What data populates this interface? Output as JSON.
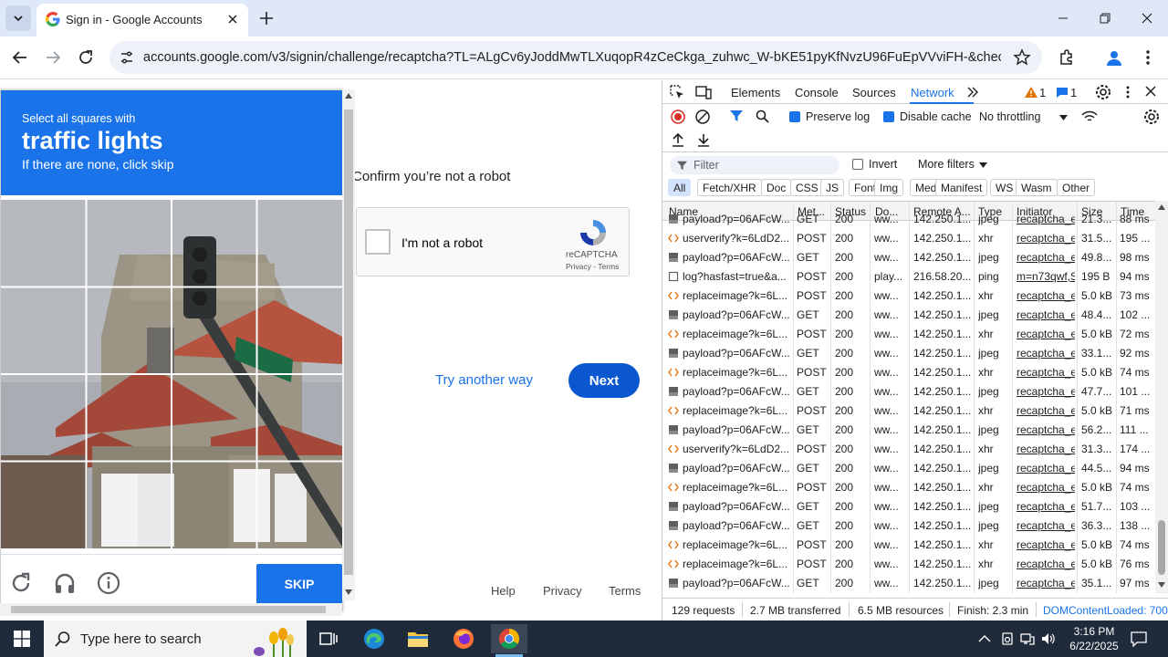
{
  "browser": {
    "tab_title": "Sign in - Google Accounts",
    "url": "accounts.google.com/v3/signin/challenge/recaptcha?TL=ALgCv6yJoddMwTLXuqopR4zCeCkga_zuhwc_W-bKE51pyKfNvzU96FuEpVVviFH-&checkConn..."
  },
  "captcha": {
    "instruction_line1": "Select all squares with",
    "instruction_target": "traffic lights",
    "instruction_line3": "If there are none, click skip",
    "skip_label": "SKIP",
    "icons": [
      "reload-icon",
      "headphones-icon",
      "info-icon"
    ]
  },
  "signin": {
    "confirm_text": "Confirm you’re not a robot",
    "checkbox_label": "I'm not a robot",
    "recaptcha_brand": "reCAPTCHA",
    "privacy_terms": "Privacy - Terms",
    "try_another": "Try another way",
    "next": "Next",
    "footer": {
      "help": "Help",
      "privacy": "Privacy",
      "terms": "Terms"
    }
  },
  "devtools": {
    "tabs": [
      "Elements",
      "Console",
      "Sources",
      "Network"
    ],
    "active_tab": "Network",
    "warnings": "1",
    "messages": "1",
    "preserve_log": "Preserve log",
    "disable_cache": "Disable cache",
    "throttling": "No throttling",
    "filter_placeholder": "Filter",
    "invert": "Invert",
    "more_filters": "More filters",
    "type_filters": [
      "All",
      "Fetch/XHR",
      "Doc",
      "CSS",
      "JS",
      "Font",
      "Img",
      "Media",
      "Manifest",
      "WS",
      "Wasm",
      "Other"
    ],
    "columns": [
      "Name",
      "Met...",
      "Status",
      "Do...",
      "Remote A...",
      "Type",
      "Initiator",
      "Size",
      "Time"
    ],
    "rows": [
      {
        "name": "payload?p=06AFcW...",
        "method": "GET",
        "status": "200",
        "domain": "ww...",
        "remote": "142.250.1...",
        "type": "jpeg",
        "initiator": "recaptcha_e",
        "size": "21.3...",
        "time": "88 ms",
        "icon": "img"
      },
      {
        "name": "userverify?k=6LdD2...",
        "method": "POST",
        "status": "200",
        "domain": "ww...",
        "remote": "142.250.1...",
        "type": "xhr",
        "initiator": "recaptcha_e",
        "size": "31.5...",
        "time": "195 ...",
        "icon": "xhr"
      },
      {
        "name": "payload?p=06AFcW...",
        "method": "GET",
        "status": "200",
        "domain": "ww...",
        "remote": "142.250.1...",
        "type": "jpeg",
        "initiator": "recaptcha_e",
        "size": "49.8...",
        "time": "98 ms",
        "icon": "img"
      },
      {
        "name": "log?hasfast=true&a...",
        "method": "POST",
        "status": "200",
        "domain": "play...",
        "remote": "216.58.20...",
        "type": "ping",
        "initiator": "m=n73qwf,S",
        "size": "195 B",
        "time": "94 ms",
        "icon": "doc"
      },
      {
        "name": "replaceimage?k=6L...",
        "method": "POST",
        "status": "200",
        "domain": "ww...",
        "remote": "142.250.1...",
        "type": "xhr",
        "initiator": "recaptcha_e",
        "size": "5.0 kB",
        "time": "73 ms",
        "icon": "xhr"
      },
      {
        "name": "payload?p=06AFcW...",
        "method": "GET",
        "status": "200",
        "domain": "ww...",
        "remote": "142.250.1...",
        "type": "jpeg",
        "initiator": "recaptcha_e",
        "size": "48.4...",
        "time": "102 ...",
        "icon": "img"
      },
      {
        "name": "replaceimage?k=6L...",
        "method": "POST",
        "status": "200",
        "domain": "ww...",
        "remote": "142.250.1...",
        "type": "xhr",
        "initiator": "recaptcha_e",
        "size": "5.0 kB",
        "time": "72 ms",
        "icon": "xhr"
      },
      {
        "name": "payload?p=06AFcW...",
        "method": "GET",
        "status": "200",
        "domain": "ww...",
        "remote": "142.250.1...",
        "type": "jpeg",
        "initiator": "recaptcha_e",
        "size": "33.1...",
        "time": "92 ms",
        "icon": "img"
      },
      {
        "name": "replaceimage?k=6L...",
        "method": "POST",
        "status": "200",
        "domain": "ww...",
        "remote": "142.250.1...",
        "type": "xhr",
        "initiator": "recaptcha_e",
        "size": "5.0 kB",
        "time": "74 ms",
        "icon": "xhr"
      },
      {
        "name": "payload?p=06AFcW...",
        "method": "GET",
        "status": "200",
        "domain": "ww...",
        "remote": "142.250.1...",
        "type": "jpeg",
        "initiator": "recaptcha_e",
        "size": "47.7...",
        "time": "101 ...",
        "icon": "img"
      },
      {
        "name": "replaceimage?k=6L...",
        "method": "POST",
        "status": "200",
        "domain": "ww...",
        "remote": "142.250.1...",
        "type": "xhr",
        "initiator": "recaptcha_e",
        "size": "5.0 kB",
        "time": "71 ms",
        "icon": "xhr"
      },
      {
        "name": "payload?p=06AFcW...",
        "method": "GET",
        "status": "200",
        "domain": "ww...",
        "remote": "142.250.1...",
        "type": "jpeg",
        "initiator": "recaptcha_e",
        "size": "56.2...",
        "time": "111 ...",
        "icon": "img"
      },
      {
        "name": "userverify?k=6LdD2...",
        "method": "POST",
        "status": "200",
        "domain": "ww...",
        "remote": "142.250.1...",
        "type": "xhr",
        "initiator": "recaptcha_e",
        "size": "31.3...",
        "time": "174 ...",
        "icon": "xhr"
      },
      {
        "name": "payload?p=06AFcW...",
        "method": "GET",
        "status": "200",
        "domain": "ww...",
        "remote": "142.250.1...",
        "type": "jpeg",
        "initiator": "recaptcha_e",
        "size": "44.5...",
        "time": "94 ms",
        "icon": "img"
      },
      {
        "name": "replaceimage?k=6L...",
        "method": "POST",
        "status": "200",
        "domain": "ww...",
        "remote": "142.250.1...",
        "type": "xhr",
        "initiator": "recaptcha_e",
        "size": "5.0 kB",
        "time": "74 ms",
        "icon": "xhr"
      },
      {
        "name": "payload?p=06AFcW...",
        "method": "GET",
        "status": "200",
        "domain": "ww...",
        "remote": "142.250.1...",
        "type": "jpeg",
        "initiator": "recaptcha_e",
        "size": "51.7...",
        "time": "103 ...",
        "icon": "img"
      },
      {
        "name": "payload?p=06AFcW...",
        "method": "GET",
        "status": "200",
        "domain": "ww...",
        "remote": "142.250.1...",
        "type": "jpeg",
        "initiator": "recaptcha_e",
        "size": "36.3...",
        "time": "138 ...",
        "icon": "img"
      },
      {
        "name": "replaceimage?k=6L...",
        "method": "POST",
        "status": "200",
        "domain": "ww...",
        "remote": "142.250.1...",
        "type": "xhr",
        "initiator": "recaptcha_e",
        "size": "5.0 kB",
        "time": "74 ms",
        "icon": "xhr"
      },
      {
        "name": "replaceimage?k=6L...",
        "method": "POST",
        "status": "200",
        "domain": "ww...",
        "remote": "142.250.1...",
        "type": "xhr",
        "initiator": "recaptcha_e",
        "size": "5.0 kB",
        "time": "76 ms",
        "icon": "xhr"
      },
      {
        "name": "payload?p=06AFcW...",
        "method": "GET",
        "status": "200",
        "domain": "ww...",
        "remote": "142.250.1...",
        "type": "jpeg",
        "initiator": "recaptcha_e",
        "size": "35.1...",
        "time": "97 ms",
        "icon": "img"
      }
    ],
    "status_bar": {
      "requests": "129 requests",
      "transferred": "2.7 MB transferred",
      "resources": "6.5 MB resources",
      "finish": "Finish: 2.3 min",
      "dcl": "DOMContentLoaded: 700"
    }
  },
  "taskbar": {
    "search_placeholder": "Type here to search",
    "time": "3:16 PM",
    "date": "6/22/2025"
  },
  "colors": {
    "google_blue": "#1a73e8",
    "next_blue": "#0b57d0",
    "taskbar": "#1f2a3a",
    "tabbar": "#dfe8f7"
  }
}
